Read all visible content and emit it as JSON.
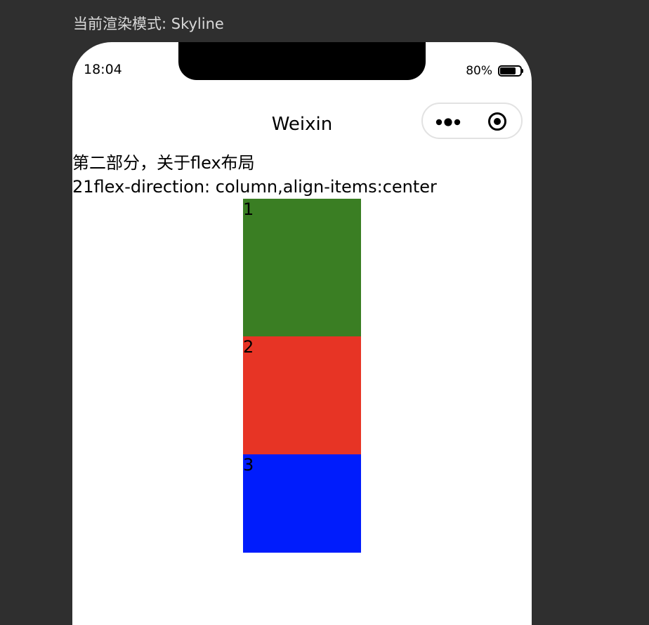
{
  "window": {
    "render_mode_label": "当前渲染模式: Skyline"
  },
  "status_bar": {
    "time": "18:04",
    "battery_percent": "80%",
    "battery_level": 0.8
  },
  "nav_bar": {
    "title": "Weixin",
    "capsule_icons": [
      "more-dots-icon",
      "close-target-icon"
    ]
  },
  "content": {
    "section_title": "第二部分，关于flex布局",
    "example_label": "21flex-direction: column,align-items:center",
    "items": [
      {
        "label": "1",
        "color": "#3a7e23"
      },
      {
        "label": "2",
        "color": "#e73425"
      },
      {
        "label": "3",
        "color": "#001cfc"
      }
    ]
  }
}
